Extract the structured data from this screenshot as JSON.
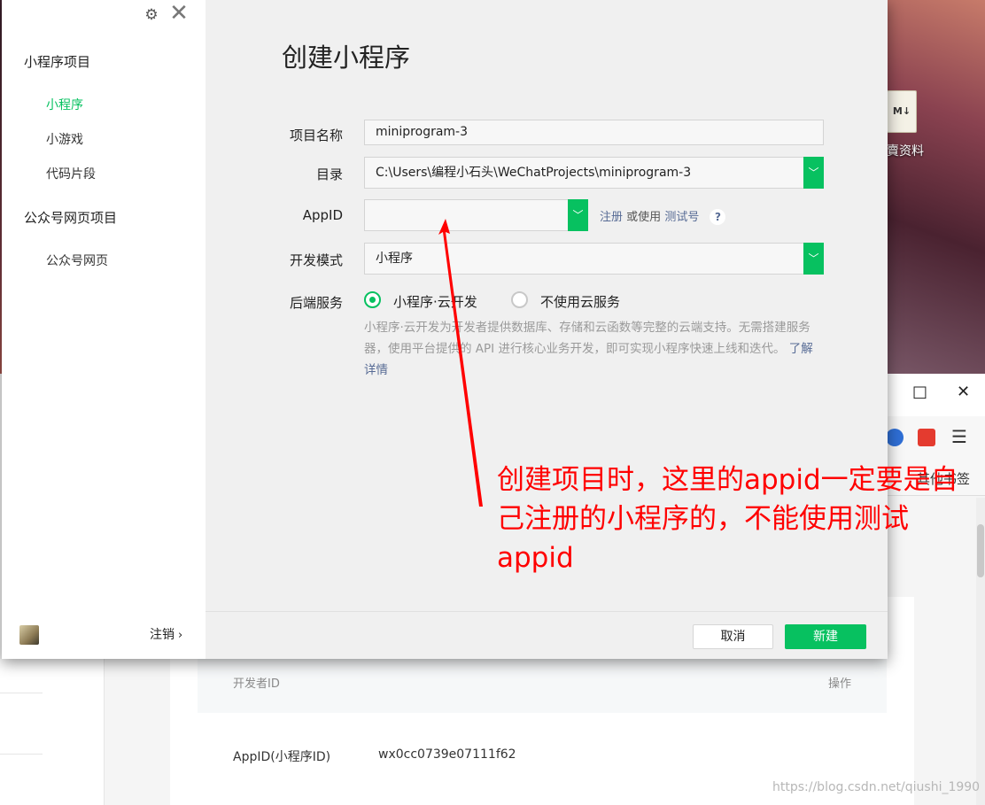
{
  "desktop": {
    "icon_glyph": "M↓",
    "icon_label": "賣资料"
  },
  "browser": {
    "bookmark_label": "其他书签",
    "watermark": "https://blog.csdn.net/qiushi_1990",
    "table": {
      "headers": [
        "开发者ID",
        "操作"
      ],
      "rows": [
        {
          "key": "AppID(小程序ID)",
          "value": "wx0cc0739e07111f62"
        }
      ]
    }
  },
  "dialog": {
    "title": "创建小程序",
    "sidebar": {
      "section_miniprogram": "小程序项目",
      "items_miniprogram": [
        {
          "label": "小程序",
          "active": true
        },
        {
          "label": "小游戏",
          "active": false
        },
        {
          "label": "代码片段",
          "active": false
        }
      ],
      "section_official": "公众号网页项目",
      "items_official": [
        {
          "label": "公众号网页",
          "active": false
        }
      ],
      "logout_label": "注销",
      "logout_chevron": "›"
    },
    "form": {
      "project_name_label": "项目名称",
      "project_name_value": "miniprogram-3",
      "directory_label": "目录",
      "directory_value": "C:\\Users\\编程小石头\\WeChatProjects\\miniprogram-3",
      "appid_label": "AppID",
      "appid_value": "",
      "appid_register_link": "注册",
      "appid_or_text": "或使用",
      "appid_test_link": "测试号",
      "appid_help": "?",
      "dev_mode_label": "开发模式",
      "dev_mode_value": "小程序",
      "backend_label": "后端服务",
      "backend_option_cloud": "小程序·云开发",
      "backend_option_none": "不使用云服务",
      "backend_selected": "cloud",
      "description": "小程序·云开发为开发者提供数据库、存储和云函数等完整的云端支持。无需搭建服务器，使用平台提供的 API 进行核心业务开发，即可实现小程序快速上线和迭代。",
      "learn_more_link": "了解详情"
    },
    "footer": {
      "cancel_label": "取消",
      "create_label": "新建"
    }
  },
  "annotation": {
    "text": "创建项目时，这里的appid一定要是自己注册的小程序的，不能使用测试appid",
    "color": "#ff0000"
  },
  "colors": {
    "accent": "#07c160",
    "link": "#576b95"
  }
}
